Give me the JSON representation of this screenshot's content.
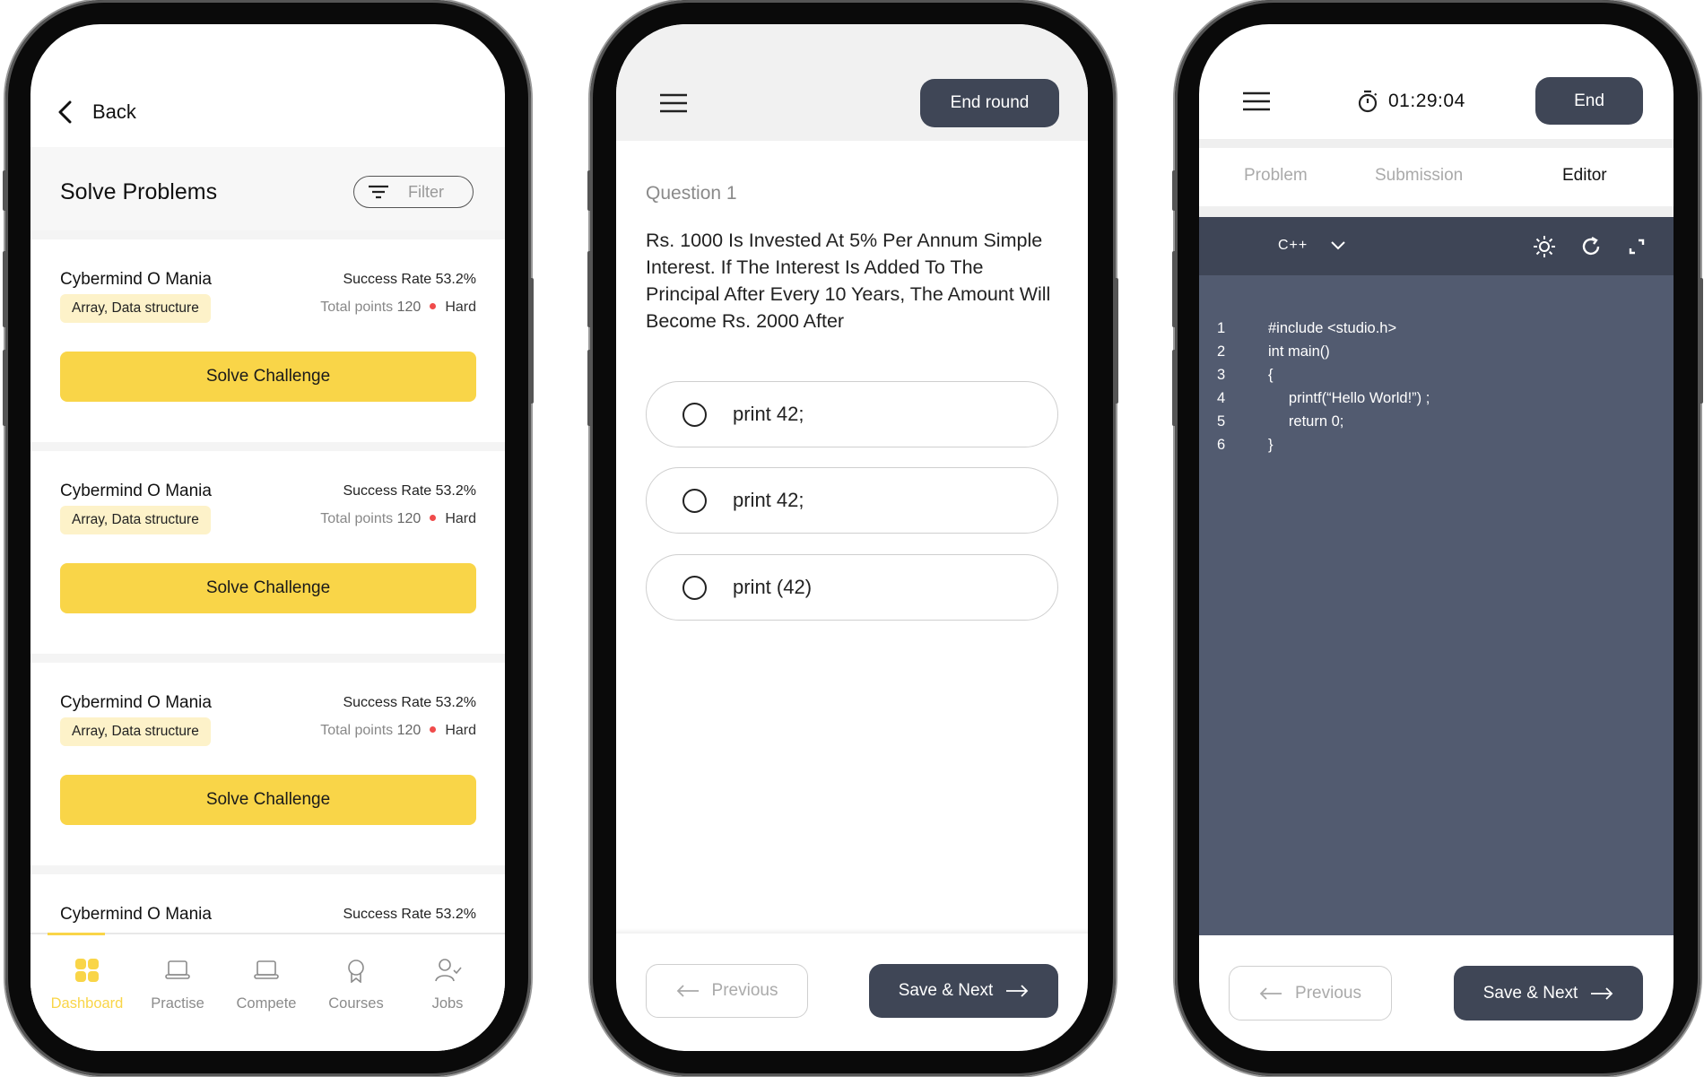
{
  "colors": {
    "accent_yellow": "#f9d548",
    "tag_bg": "#fdf2c9",
    "dark_button": "#3f4656",
    "editor_toolbar": "#3e4556",
    "editor_bg": "#525b70",
    "difficulty_dot": "#f04b4b"
  },
  "screen1": {
    "back_label": "Back",
    "title": "Solve Problems",
    "filter_label": "Filter",
    "cards": [
      {
        "title": "Cybermind O Mania",
        "success_rate": "Success Rate 53.2%",
        "tag": "Array, Data structure",
        "points_label": "Total points",
        "points": "120",
        "difficulty": "Hard",
        "button": "Solve Challenge"
      },
      {
        "title": "Cybermind O Mania",
        "success_rate": "Success Rate 53.2%",
        "tag": "Array, Data structure",
        "points_label": "Total points",
        "points": "120",
        "difficulty": "Hard",
        "button": "Solve Challenge"
      },
      {
        "title": "Cybermind O Mania",
        "success_rate": "Success Rate 53.2%",
        "tag": "Array, Data structure",
        "points_label": "Total points",
        "points": "120",
        "difficulty": "Hard",
        "button": "Solve Challenge"
      },
      {
        "title": "Cybermind O Mania",
        "success_rate": "Success Rate 53.2%"
      }
    ],
    "nav": [
      {
        "label": "Dashboard",
        "icon": "grid-icon",
        "active": true
      },
      {
        "label": "Practise",
        "icon": "laptop-icon"
      },
      {
        "label": "Compete",
        "icon": "laptop-icon"
      },
      {
        "label": "Courses",
        "icon": "award-icon"
      },
      {
        "label": "Jobs",
        "icon": "user-check-icon"
      }
    ]
  },
  "screen2": {
    "end_round_label": "End round",
    "question_label": "Question 1",
    "question_text": "Rs. 1000 Is Invested At 5% Per Annum Simple Interest. If The Interest Is Added To The Principal After Every 10 Years, The Amount Will Become Rs. 2000 After",
    "options": [
      "print 42;",
      "print 42;",
      "print (42)"
    ],
    "previous_label": "Previous",
    "save_next_label": "Save & Next"
  },
  "screen3": {
    "timer": "01:29:04",
    "end_label": "End",
    "tabs": [
      {
        "label": "Problem"
      },
      {
        "label": "Submission"
      },
      {
        "label": "Editor",
        "active": true
      }
    ],
    "language": "C++",
    "code_lines": [
      {
        "n": "1",
        "text": "#include <studio.h>"
      },
      {
        "n": "2",
        "text": "int main()"
      },
      {
        "n": "3",
        "text": "{"
      },
      {
        "n": "4",
        "text": "     printf(“Hello World!”) ;"
      },
      {
        "n": "5",
        "text": "     return 0;"
      },
      {
        "n": "6",
        "text": "}"
      }
    ],
    "previous_label": "Previous",
    "save_next_label": "Save & Next"
  }
}
